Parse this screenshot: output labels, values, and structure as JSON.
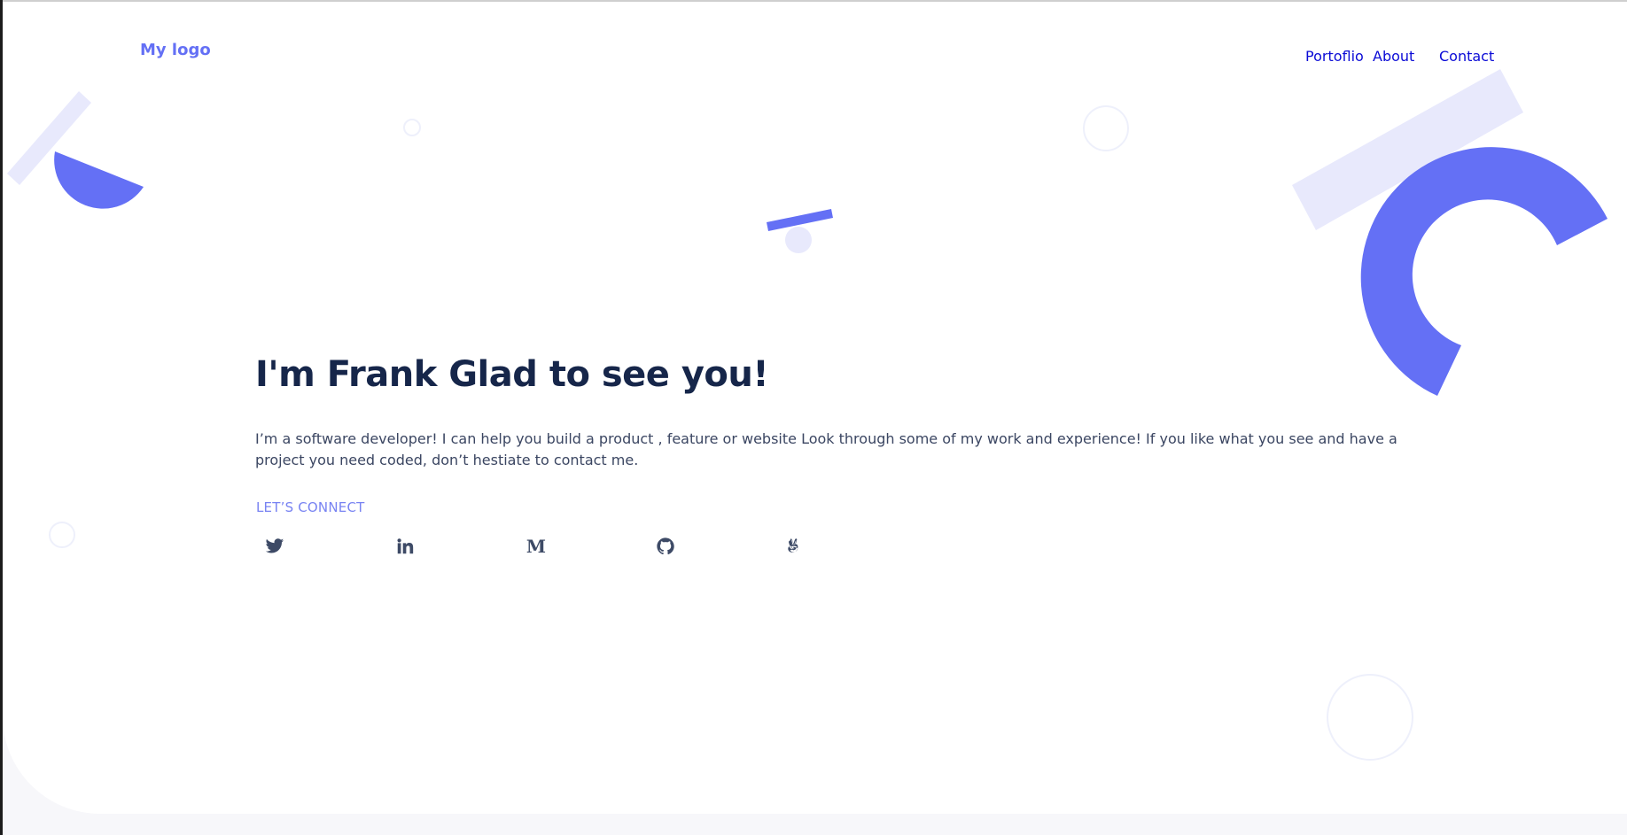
{
  "header": {
    "logo": "My logo",
    "nav": [
      "Portoflio",
      "About",
      "Contact"
    ]
  },
  "hero": {
    "headline": "I'm Frank Glad to see you!",
    "intro": "I’m a software developer! I can help you build a product , feature or website Look through some of my work and experience! If you like what you see and have a project you need coded, don’t hestiate to contact me.",
    "connect_label": "LET’S CONNECT"
  },
  "socials": [
    {
      "icon": "twitter-icon"
    },
    {
      "icon": "linkedin-icon"
    },
    {
      "icon": "medium-icon",
      "glyph": "M"
    },
    {
      "icon": "github-icon"
    },
    {
      "icon": "angellist-icon"
    }
  ],
  "colors": {
    "accent": "#6470f5",
    "nav_link": "#0b0bd6",
    "headline": "#16264a",
    "body_text": "#3b4662",
    "decor_light": "#e8e9fc"
  }
}
